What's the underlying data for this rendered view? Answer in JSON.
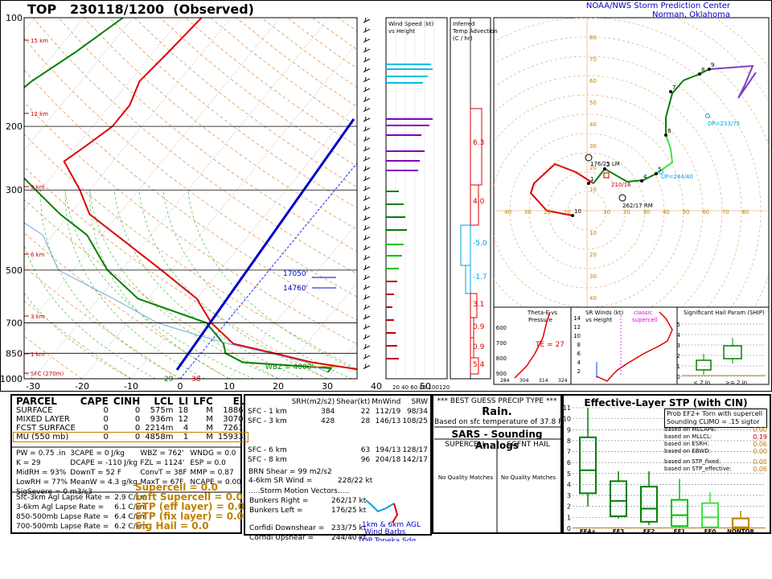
{
  "header": {
    "station": "TOP",
    "datetime": "230118/1200",
    "type": "(Observed)",
    "org_line1": "NOAA/NWS Storm Prediction Center",
    "org_line2": "Norman, Oklahoma"
  },
  "skewt": {
    "pressure_ticks": [
      "100",
      "200",
      "300",
      "500",
      "700",
      "850",
      "1000"
    ],
    "temp_ticks": [
      "-30",
      "-20",
      "-10",
      "0",
      "10",
      "20",
      "30",
      "40",
      "50"
    ],
    "height_labels": [
      "15 km",
      "12 km",
      "9 km",
      "6 km",
      "3 km",
      "1 km",
      "SFC (270m)"
    ],
    "annotations": {
      "h17050": "17050'",
      "h14760": "14760'",
      "wbz": "WBZ = 4000'",
      "sfc_t": "38",
      "sfc_td": "29"
    }
  },
  "wind_panel": {
    "title1": "Wind Speed (kt)",
    "title2": "vs Height",
    "axis": "20 40 60 80 100120"
  },
  "adv_panel": {
    "title1": "Inferred",
    "title2": "Temp Advection",
    "title3": "(C / hr)",
    "vals": [
      "6.3",
      "4.0",
      "-5.0",
      "-1.7",
      "3.1",
      "0.9",
      "0.9",
      "5.4"
    ]
  },
  "theta_panel": {
    "title1": "Theta-E vs",
    "title2": "Pressure",
    "te": "TE = 27",
    "pticks": [
      "600",
      "700",
      "800",
      "900"
    ],
    "xticks": [
      "284",
      "304",
      "314",
      "324"
    ]
  },
  "sr_panel": {
    "title1": "SR Winds (kt)",
    "title2": "vs Height",
    "classic": "classic",
    "supercell": "supercell",
    "hticks": [
      "14",
      "12",
      "10",
      "8",
      "6",
      "4",
      "2"
    ]
  },
  "ship_panel": {
    "title": "Significant Hail Param (SHIP)",
    "lt2": "< 2 in",
    "ge2": ">= 2 in",
    "yticks": [
      "5",
      "4",
      "3",
      "2",
      "1",
      "0"
    ]
  },
  "hodo": {
    "rings": [
      "10",
      "20",
      "30",
      "40",
      "50",
      "60",
      "70",
      "80"
    ],
    "labels": {
      "lm": "176/25 LM",
      "rm": "262/17 RM",
      "mw": "210/16",
      "up": "UP=244/40",
      "dp": "DP=233/75"
    },
    "pts": [
      "2",
      "1",
      "4",
      "5",
      "6",
      "7",
      "8",
      "9",
      "10"
    ]
  },
  "chart_data": {
    "type": "line",
    "title": "TOP  230118/1200  (Observed)",
    "xlabel": "",
    "ylabel": "",
    "xlim": [
      -30,
      50
    ],
    "ylim": [
      1000,
      100
    ],
    "series": [
      {
        "name": "",
        "x": [
          38,
          33,
          24,
          15,
          5,
          -3,
          -10,
          -22,
          -37,
          -46,
          -52,
          -60,
          -58,
          -56,
          -56,
          -58,
          -57,
          -56
        ],
        "y": [
          960,
          935,
          900,
          850,
          800,
          700,
          600,
          500,
          400,
          350,
          300,
          250,
          225,
          200,
          175,
          150,
          125,
          100
        ]
      },
      {
        "name": "",
        "x": [
          29,
          29,
          10,
          5,
          3,
          -4,
          -22,
          -33,
          -43,
          -52,
          -61,
          -66,
          -82,
          -85,
          -84,
          -82,
          -80,
          -76,
          -72
        ],
        "y": [
          960,
          935,
          900,
          850,
          800,
          700,
          600,
          500,
          400,
          350,
          300,
          275,
          250,
          225,
          200,
          175,
          150,
          125,
          100
        ]
      },
      {
        "name": "",
        "x": [
          29,
          23,
          14,
          4,
          -5,
          -14,
          -27,
          -43,
          -52,
          -62,
          -74
        ],
        "y": [
          960,
          900,
          850,
          800,
          750,
          700,
          600,
          500,
          400,
          350,
          300
        ]
      }
    ]
  },
  "parcel_table": {
    "headers": [
      "PARCEL",
      "CAPE",
      "CINH",
      "LCL",
      "LI",
      "LFC",
      "EL"
    ],
    "rows": [
      [
        "SURFACE",
        "0",
        "0",
        "575m",
        "18",
        "M",
        "1886'"
      ],
      [
        "MIXED LAYER",
        "0",
        "0",
        "936m",
        "12",
        "M",
        "3070'"
      ],
      [
        "FCST SURFACE",
        "0",
        "0",
        "2214m",
        "4",
        "M",
        "7261'"
      ],
      [
        "MU   (550 mb)",
        "0",
        "0",
        "4858m",
        "1",
        "M",
        "15933'"
      ]
    ],
    "indices": [
      [
        "PW = 0.75 .in",
        "3CAPE = 0 J/kg",
        "WBZ = 762'",
        "WNDG = 0.0"
      ],
      [
        "K = 29",
        "DCAPE = -110 J/kg",
        "FZL = 1124'",
        "ESP = 0.0"
      ],
      [
        "MidRH = 93%",
        "DownT = 52 F",
        "ConvT = 38F",
        "MMP = 0.87"
      ],
      [
        "LowRH = 77%",
        "MeanW = 4.3 g/kg",
        "MaxT = 67F",
        "NCAPE = 0.00"
      ],
      [
        "SigSevere = 0 m3/s3",
        "",
        "",
        ""
      ]
    ],
    "lapse": [
      [
        "Sfc-3km Agl Lapse Rate =",
        "2.9 C/km"
      ],
      [
        "3-6km Agl Lapse Rate =",
        "6.1 C/km"
      ],
      [
        "850-500mb Lapse Rate =",
        "6.4 C/km"
      ],
      [
        "700-500mb Lapse Rate =",
        "6.2 C/km"
      ]
    ],
    "composites": [
      "Supercell = 0.0",
      "Left Supercell = 0.0",
      "STP (eff layer) = 0.0",
      "STP (fix layer) = 0.0",
      "Sig Hail = 0.0"
    ]
  },
  "kinematics": {
    "headers": [
      "SRH(m2/s2)",
      "Shear(kt)",
      "MnWind",
      "SRW"
    ],
    "rows": [
      [
        "SFC - 1 km",
        "384",
        "22",
        "112/19",
        "98/34"
      ],
      [
        "SFC - 3 km",
        "428",
        "28",
        "146/13",
        "108/25"
      ],
      [
        "SFC - 6 km",
        "",
        "63",
        "194/13",
        "128/17"
      ],
      [
        "SFC - 8 km",
        "",
        "96",
        "204/18",
        "142/17"
      ]
    ],
    "brn": [
      "BRN Shear = 99 m2/s2",
      "4-6km SR Wind =",
      "228/22 kt"
    ],
    "smv_title": ".....Storm Motion Vectors.....",
    "smv": [
      [
        "Bunkers Right =",
        "262/17 kt"
      ],
      [
        "Bunkers Left =",
        "176/25 kt"
      ],
      [
        "Corfidi Downshear =",
        "233/75 kt"
      ],
      [
        "Corfidi Upshear =",
        "244/40 kt"
      ]
    ],
    "barb_label1": "1km & 6km AGL",
    "barb_label2": "Wind Barbs",
    "footer": "TOP Topeka Sdg"
  },
  "precip": {
    "title": "*** BEST GUESS PRECIP TYPE ***",
    "value": "Rain.",
    "basis": "Based on sfc temperature of 37.8 F."
  },
  "sars": {
    "title": "SARS - Sounding Analogs",
    "col1": "SUPERCELL",
    "col2": "SGFNT HAIL",
    "none1": "No Quality Matches",
    "none2": "No Quality Matches"
  },
  "stp": {
    "title": "Effective-Layer STP (with CIN)",
    "prob1": "Prob EF2+ Torn with supercell",
    "prob2": "Sounding CLIMO = .15 sigtor",
    "lines": [
      [
        "based on MLCAPE:",
        "0.00"
      ],
      [
        "based on MLLCL:",
        "0.19"
      ],
      [
        "based on ESRH:",
        "0.06"
      ],
      [
        "based on EBWD:",
        "0.00"
      ],
      [
        "based on STP_fixed:",
        "0.05"
      ],
      [
        "based on STP_effective:",
        "0.06"
      ]
    ],
    "cats": [
      "EF4+",
      "EF3",
      "EF2",
      "EF1",
      "EF0",
      "NONTOR"
    ],
    "yticks": [
      "11",
      "10",
      "9",
      "8",
      "7",
      "6",
      "5",
      "4",
      "3",
      "2",
      "1",
      "0"
    ]
  }
}
